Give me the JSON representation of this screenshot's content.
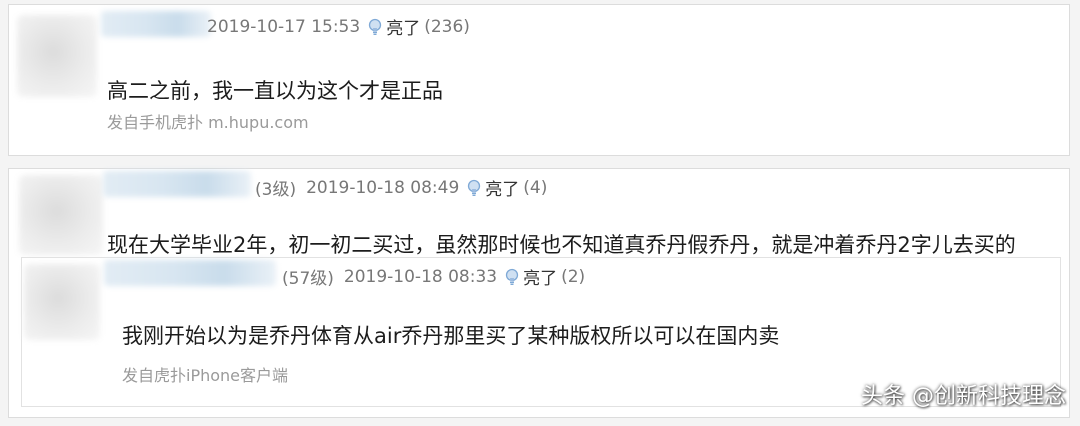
{
  "posts": [
    {
      "date": "2019-10-17 15:53",
      "liang_label": "亮了",
      "liang_count": "(236)",
      "content": "高二之前，我一直以为这个才是正品",
      "source": "发自手机虎扑 m.hupu.com"
    },
    {
      "level": "(3级)",
      "date": "2019-10-18 08:49",
      "liang_label": "亮了",
      "liang_count": "(4)",
      "content": "现在大学毕业2年，初一初二买过，虽然那时候也不知道真乔丹假乔丹，就是冲着乔丹2字儿去买的"
    }
  ],
  "reply": {
    "level": "(57级)",
    "date": "2019-10-18 08:33",
    "liang_label": "亮了",
    "liang_count": "(2)",
    "content": "我刚开始以为是乔丹体育从air乔丹那里买了某种版权所以可以在国内卖",
    "source": "发自虎扑iPhone客户端"
  },
  "watermark": "头条 @创新科技理念",
  "colors": {
    "meta": "#777777",
    "source": "#9a9a9a",
    "text": "#1c1c1c",
    "bulb": "#7fa9d6"
  },
  "icons": {
    "light": "lightbulb-icon"
  }
}
